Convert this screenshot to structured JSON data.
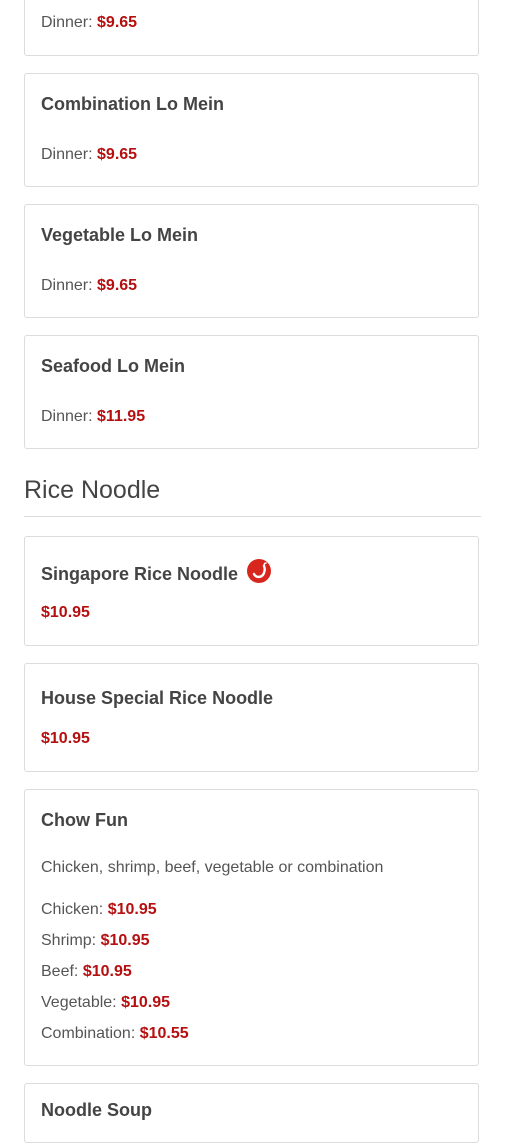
{
  "colors": {
    "price": "#b50f0f",
    "border": "#dcdcdc",
    "spicy": "#d7261e"
  },
  "lo_mein_items": [
    {
      "title": "",
      "lines": [
        {
          "label": "Dinner:",
          "price": "$9.65"
        }
      ]
    },
    {
      "title": "Combination Lo Mein",
      "lines": [
        {
          "label": "Dinner:",
          "price": "$9.65"
        }
      ]
    },
    {
      "title": "Vegetable Lo Mein",
      "lines": [
        {
          "label": "Dinner:",
          "price": "$9.65"
        }
      ]
    },
    {
      "title": "Seafood Lo Mein",
      "lines": [
        {
          "label": "Dinner:",
          "price": "$11.95"
        }
      ]
    }
  ],
  "rice_noodle": {
    "heading": "Rice Noodle",
    "items": [
      {
        "title": "Singapore Rice Noodle",
        "spicy_icon": "chili-pepper-icon",
        "price": "$10.95"
      },
      {
        "title": "House Special Rice Noodle",
        "price": "$10.95"
      },
      {
        "title": "Chow Fun",
        "description": "Chicken, shrimp, beef, vegetable or combination",
        "lines": [
          {
            "label": "Chicken:",
            "price": "$10.95"
          },
          {
            "label": "Shrimp:",
            "price": "$10.95"
          },
          {
            "label": "Beef:",
            "price": "$10.95"
          },
          {
            "label": "Vegetable:",
            "price": "$10.95"
          },
          {
            "label": "Combination:",
            "price": "$10.55"
          }
        ]
      },
      {
        "title": "Noodle Soup"
      }
    ]
  }
}
